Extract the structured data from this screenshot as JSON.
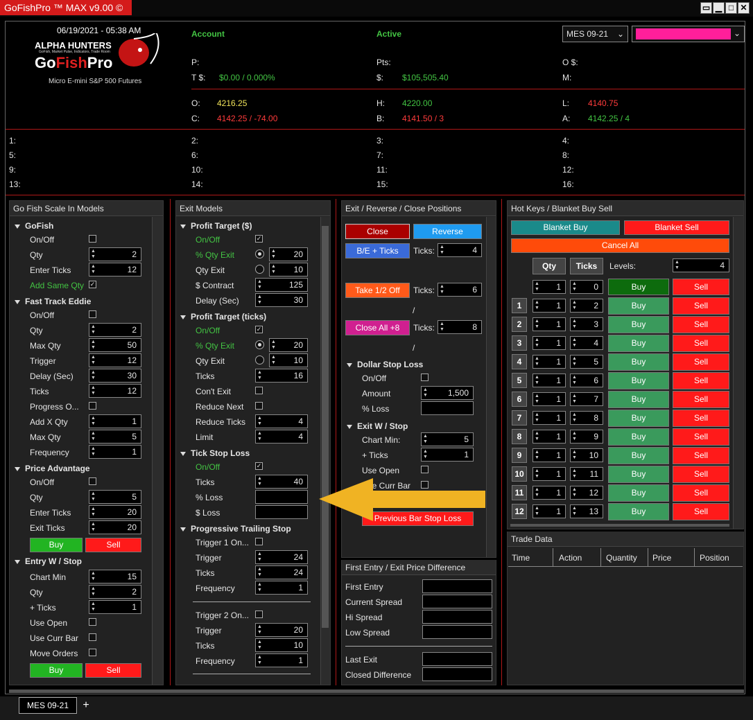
{
  "window": {
    "title": "GoFishPro ™ MAX v9.00 ©",
    "btn_a": "▭",
    "btn_min": "▁",
    "btn_max": "□",
    "btn_close": "✕"
  },
  "header": {
    "datetime": "06/19/2021 - 05:38 AM",
    "logo_top": "ALPHA HUNTERS",
    "logo_sub": "GoFish, Market Pulse, Indicators, Trade Room",
    "logo_main_a": "Go",
    "logo_main_b": "Fish",
    "logo_main_c": "Pro",
    "product": "Micro E-mini S&P 500 Futures",
    "account_label": "Account",
    "active_label": "Active",
    "instrument": "MES 09-21",
    "p_label": "P:",
    "pts_label": "Pts:",
    "o_dollar_label": "O $:",
    "t_label": "T $:",
    "t_value": "$0.00 / 0.000%",
    "dollar_label": "$:",
    "dollar_value": "$105,505.40",
    "m_label": "M:",
    "o_label": "O:",
    "o_value": "4216.25",
    "h_label": "H:",
    "h_value": "4220.00",
    "l_label": "L:",
    "l_value": "4140.75",
    "c_label": "C:",
    "c_value": "4142.25 / -74.00",
    "b_label": "B:",
    "b_value": "4141.50 / 3",
    "a_label": "A:",
    "a_value": "4142.25 / 4"
  },
  "slots": [
    "1:",
    "2:",
    "3:",
    "4:",
    "5:",
    "6:",
    "7:",
    "8:",
    "9:",
    "10:",
    "11:",
    "12:",
    "13:",
    "14:",
    "15:",
    "16:"
  ],
  "scale_in": {
    "title": "Go Fish Scale In Models",
    "gofish": {
      "title": "GoFish",
      "onoff": "On/Off",
      "qty": "Qty",
      "qty_v": "2",
      "enter": "Enter Ticks",
      "enter_v": "12",
      "add_same": "Add Same Qty"
    },
    "fte": {
      "title": "Fast Track Eddie",
      "onoff": "On/Off",
      "qty": "Qty",
      "qty_v": "2",
      "maxqty": "Max Qty",
      "maxqty_v": "50",
      "trigger": "Trigger",
      "trigger_v": "12",
      "delay": "Delay (Sec)",
      "delay_v": "30",
      "ticks": "Ticks",
      "ticks_v": "12",
      "progress": "Progress O...",
      "addx": "Add X Qty",
      "addx_v": "1",
      "maxqty2": "Max Qty",
      "maxqty2_v": "5",
      "freq": "Frequency",
      "freq_v": "1"
    },
    "pa": {
      "title": "Price Advantage",
      "onoff": "On/Off",
      "qty": "Qty",
      "qty_v": "5",
      "enter": "Enter Ticks",
      "enter_v": "20",
      "exit": "Exit Ticks",
      "exit_v": "20",
      "buy": "Buy",
      "sell": "Sell"
    },
    "ews": {
      "title": "Entry W / Stop",
      "chartmin": "Chart Min",
      "chartmin_v": "15",
      "qty": "Qty",
      "qty_v": "2",
      "plus": "+ Ticks",
      "plus_v": "1",
      "useopen": "Use Open",
      "usecurr": "Use Curr Bar",
      "move": "Move Orders",
      "buy": "Buy",
      "sell": "Sell"
    }
  },
  "exit_models": {
    "title": "Exit Models",
    "pt": {
      "title": "Profit Target ($)",
      "onoff": "On/Off",
      "pqe": "% Qty Exit",
      "pqe_v": "20",
      "qe": "Qty Exit",
      "qe_v": "10",
      "contract": "$ Contract",
      "contract_v": "125",
      "delay": "Delay (Sec)",
      "delay_v": "30"
    },
    "ptt": {
      "title": "Profit Target (ticks)",
      "onoff": "On/Off",
      "pqe": "% Qty Exit",
      "pqe_v": "20",
      "qe": "Qty Exit",
      "qe_v": "10",
      "ticks": "Ticks",
      "ticks_v": "16",
      "cont": "Con't Exit",
      "reduce_next": "Reduce Next",
      "reduce_ticks": "Reduce Ticks",
      "reduce_ticks_v": "4",
      "limit": "Limit",
      "limit_v": "4"
    },
    "tsl": {
      "title": "Tick Stop Loss",
      "onoff": "On/Off",
      "ticks": "Ticks",
      "ticks_v": "40",
      "ploss": "% Loss",
      "dloss": "$ Loss"
    },
    "pts": {
      "title": "Progressive Trailing Stop",
      "t1": "Trigger 1 On...",
      "trigger": "Trigger",
      "trigger_v": "24",
      "ticks": "Ticks",
      "ticks_v": "24",
      "freq": "Frequency",
      "freq_v": "1",
      "t2": "Trigger 2 On...",
      "trigger2": "Trigger",
      "trigger2_v": "20",
      "ticks2": "Ticks",
      "ticks2_v": "10",
      "freq2": "Frequency",
      "freq2_v": "1"
    }
  },
  "exit_rev": {
    "title": "Exit / Reverse / Close Positions",
    "close": "Close",
    "reverse": "Reverse",
    "be": "B/E + Ticks",
    "ticks": "Ticks:",
    "be_v": "4",
    "half": "Take 1/2 Off",
    "half_v": "6",
    "slash": "/",
    "closeall": "Close All +8",
    "closeall_v": "8",
    "dsl": {
      "title": "Dollar Stop Loss",
      "onoff": "On/Off",
      "amount": "Amount",
      "amount_v": "1,500",
      "ploss": "% Loss"
    },
    "ews": {
      "title": "Exit W / Stop",
      "chartmin": "Chart Min:",
      "chartmin_v": "5",
      "plus": "+ Ticks",
      "plus_v": "1",
      "useopen": "Use Open",
      "usecurr": "Use Curr Bar",
      "pbsl": "Previous Bar Stop Loss"
    }
  },
  "first_entry": {
    "title": "First Entry / Exit Price Difference",
    "first": "First Entry",
    "spread": "Current Spread",
    "hi": "Hi Spread",
    "low": "Low Spread",
    "last": "Last Exit",
    "closed": "Closed Difference"
  },
  "hotkeys": {
    "title": "Hot Keys / Blanket Buy Sell",
    "bbuy": "Blanket Buy",
    "bsell": "Blanket Sell",
    "cancel": "Cancel All",
    "qty": "Qty",
    "ticks": "Ticks",
    "levels": "Levels:",
    "levels_v": "4",
    "top": {
      "qty": "1",
      "ticks": "0",
      "buy": "Buy",
      "sell": "Sell"
    },
    "rows": [
      {
        "n": "1",
        "qty": "1",
        "ticks": "2",
        "buy": "Buy",
        "sell": "Sell"
      },
      {
        "n": "2",
        "qty": "1",
        "ticks": "3",
        "buy": "Buy",
        "sell": "Sell"
      },
      {
        "n": "3",
        "qty": "1",
        "ticks": "4",
        "buy": "Buy",
        "sell": "Sell"
      },
      {
        "n": "4",
        "qty": "1",
        "ticks": "5",
        "buy": "Buy",
        "sell": "Sell"
      },
      {
        "n": "5",
        "qty": "1",
        "ticks": "6",
        "buy": "Buy",
        "sell": "Sell"
      },
      {
        "n": "6",
        "qty": "1",
        "ticks": "7",
        "buy": "Buy",
        "sell": "Sell"
      },
      {
        "n": "7",
        "qty": "1",
        "ticks": "8",
        "buy": "Buy",
        "sell": "Sell"
      },
      {
        "n": "8",
        "qty": "1",
        "ticks": "9",
        "buy": "Buy",
        "sell": "Sell"
      },
      {
        "n": "9",
        "qty": "1",
        "ticks": "10",
        "buy": "Buy",
        "sell": "Sell"
      },
      {
        "n": "10",
        "qty": "1",
        "ticks": "11",
        "buy": "Buy",
        "sell": "Sell"
      },
      {
        "n": "11",
        "qty": "1",
        "ticks": "12",
        "buy": "Buy",
        "sell": "Sell"
      },
      {
        "n": "12",
        "qty": "1",
        "ticks": "13",
        "buy": "Buy",
        "sell": "Sell"
      }
    ]
  },
  "trade_data": {
    "title": "Trade Data",
    "cols": [
      "Time",
      "Action",
      "Quantity",
      "Price",
      "Position"
    ]
  },
  "tabs": {
    "active": "MES 09-21",
    "add": "+"
  },
  "colors": {
    "accent": "#d41b1b",
    "magenta": "#ff1f9a",
    "green_text": "#43c443",
    "buy_green": "#3a9a5c",
    "sell_red": "#ff1a1a",
    "arrow": "#f0b323"
  }
}
